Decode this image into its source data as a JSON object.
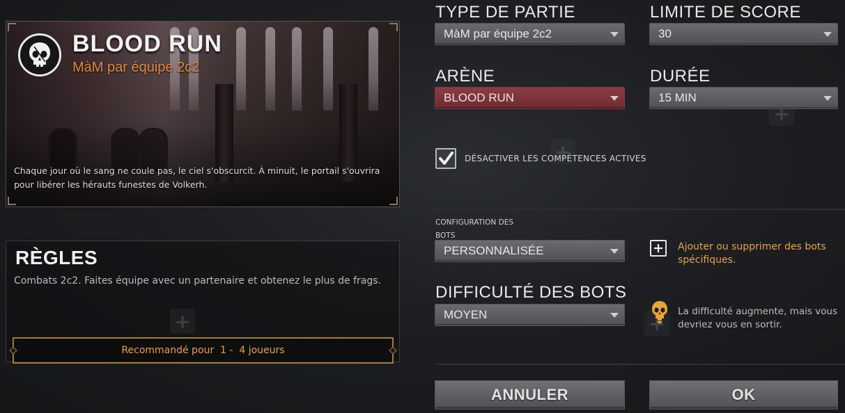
{
  "map": {
    "title": "BLOOD RUN",
    "mode": "MàM par équipe 2c2",
    "description": "Chaque jour où le sang ne coule pas, le ciel s'obscurcit. À minuit, le portail s'ouvrira pour libérer les hérauts funestes de Volkerh."
  },
  "rules": {
    "title": "RÈGLES",
    "text": "Combats 2c2. Faites équipe avec un partenaire et obtenez le plus de frags.",
    "recommended": "Recommandé pour  1 -  4 joueurs"
  },
  "settings": {
    "game_type": {
      "label": "TYPE DE PARTIE",
      "value": "MàM par équipe 2c2"
    },
    "score_limit": {
      "label": "LIMITE DE SCORE",
      "value": "30"
    },
    "arena": {
      "label": "ARÈNE",
      "value": "BLOOD RUN"
    },
    "duration": {
      "label": "DURÉE",
      "value": "15 MIN"
    },
    "disable_skills": {
      "label": "DÉSACTIVER LES COMPÉTENCES ACTIVES",
      "checked": true
    },
    "bots_config": {
      "label_line1": "CONFIGURATION DES",
      "label_line2": "BOTS",
      "value": "PERSONNALISÉE"
    },
    "bots_difficulty": {
      "label": "DIFFICULTÉ DES BOTS",
      "value": "MOYEN"
    },
    "add_bots_text": "Ajouter ou supprimer des bots spécifiques.",
    "difficulty_hint": "La difficulté augmente, mais vous devriez vous en sortir."
  },
  "actions": {
    "cancel": "ANNULER",
    "ok": "OK"
  },
  "colors": {
    "accent_orange": "#e9a24c",
    "arena_red": "#8c3c42"
  },
  "icons": [
    "skull-icon",
    "chevron-down-icon",
    "checkmark-icon",
    "plus-icon",
    "warning-skull-icon"
  ]
}
